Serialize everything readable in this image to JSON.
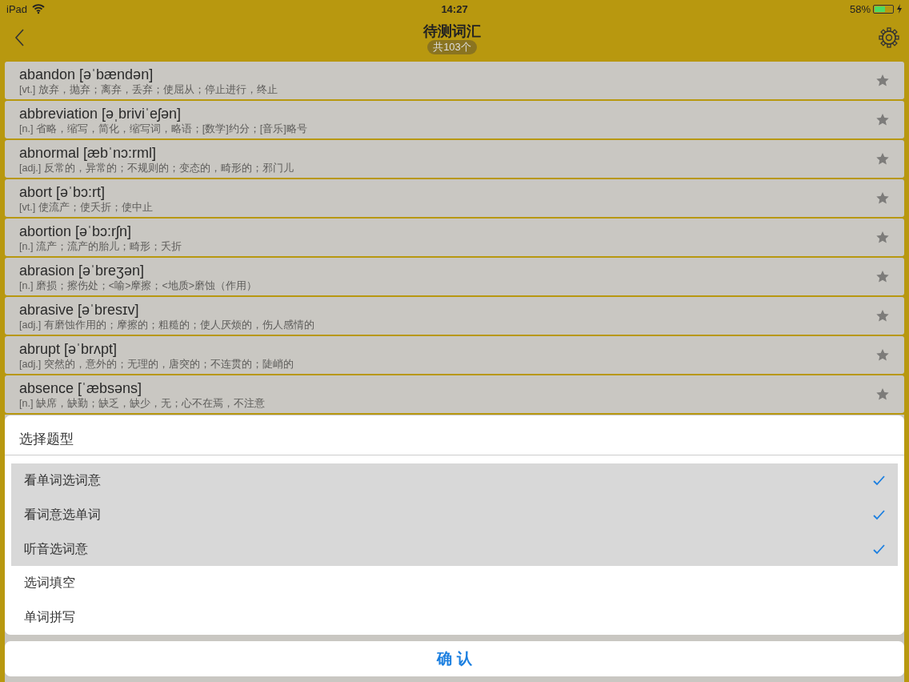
{
  "status_bar": {
    "device": "iPad",
    "time": "14:27",
    "battery": {
      "percent": "58%",
      "level": 0.58
    }
  },
  "nav": {
    "title": "待测词汇",
    "count": "共103个"
  },
  "words": [
    {
      "word": "abandon [əˈbændən]",
      "meaning": "[vt.] 放弃，抛弃；离弃，丢弃；使屈从；停止进行，终止",
      "starred": false
    },
    {
      "word": "abbreviation [əˌbriviˈeʃən]",
      "meaning": "[n.] 省略，缩写，简化，缩写词，略语；[数学]约分；[音乐]略号",
      "starred": false
    },
    {
      "word": "abnormal [æbˈnɔ:rml]",
      "meaning": "[adj.] 反常的，异常的；不规则的；变态的，畸形的；邪门儿",
      "starred": false
    },
    {
      "word": "abort [əˈbɔ:rt]",
      "meaning": "[vt.] 使流产；使夭折；使中止",
      "starred": false
    },
    {
      "word": "abortion [əˈbɔ:rʃn]",
      "meaning": "[n.] 流产；流产的胎儿；畸形；夭折",
      "starred": false
    },
    {
      "word": "abrasion [əˈbreʒən]",
      "meaning": "[n.] 磨损；擦伤处；<喻>摩擦；<地质>磨蚀（作用）",
      "starred": false
    },
    {
      "word": "abrasive [əˈbresɪv]",
      "meaning": "[adj.] 有磨蚀作用的；摩擦的；粗糙的；使人厌烦的，伤人感情的",
      "starred": false
    },
    {
      "word": "abrupt [əˈbrʌpt]",
      "meaning": "[adj.] 突然的，意外的；无理的，唐突的；不连贯的；陡峭的",
      "starred": false
    },
    {
      "word": "absence [ˈæbsəns]",
      "meaning": "[n.] 缺席，缺勤；缺乏，缺少，无；心不在焉，不注意",
      "starred": false
    }
  ],
  "sheet": {
    "title": "选择题型",
    "options": [
      {
        "label": "看单词选词意",
        "checked": true
      },
      {
        "label": "看词意选单词",
        "checked": true
      },
      {
        "label": "听音选词意",
        "checked": true
      },
      {
        "label": "选词填空",
        "checked": false
      },
      {
        "label": "单词拼写",
        "checked": false
      }
    ],
    "confirm": "确 认"
  }
}
